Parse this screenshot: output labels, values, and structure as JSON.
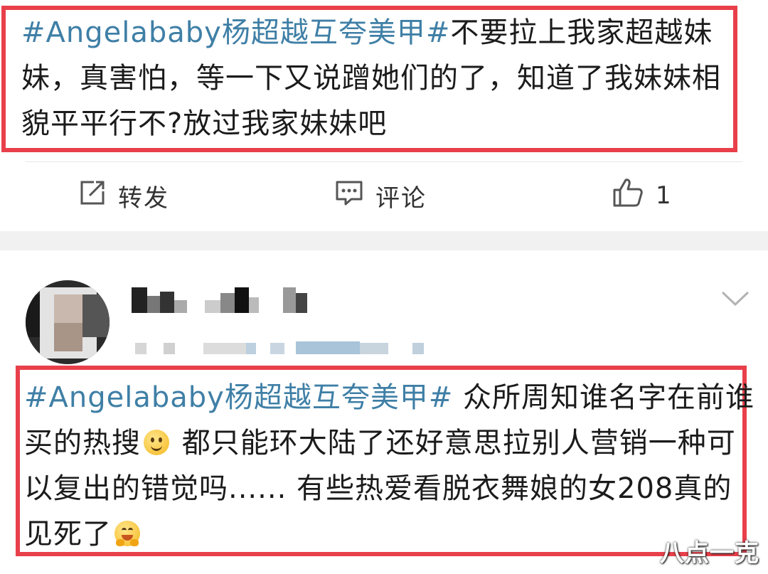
{
  "post1": {
    "hashtag": "#Angelababy杨超越互夸美甲#",
    "line1_rest": "不要拉上我家超越妹",
    "line2": "妹，真害怕，等一下又说蹭她们的了，知道了我妹妹相",
    "line3": "貌平平行不?放过我家妹妹吧"
  },
  "actions": {
    "repost_label": "转发",
    "comment_label": "评论",
    "like_count": "1"
  },
  "post2": {
    "hashtag": "#Angelababy杨超越互夸美甲#",
    "line1_rest": " 众所周知谁名字在前谁",
    "line2_a": "买的热搜",
    "line2_b": " 都只能环大陆了还好意思拉别人营销一种可",
    "line3": "以复出的错觉吗...... 有些热爱看脱衣舞娘的女208真的",
    "line4": "见死了",
    "emoji1": "smile-emoji",
    "emoji2": "hug-emoji"
  },
  "watermark": "八点一克",
  "colors": {
    "highlight": "#e8404b",
    "hashtag": "#3f7fa6"
  }
}
